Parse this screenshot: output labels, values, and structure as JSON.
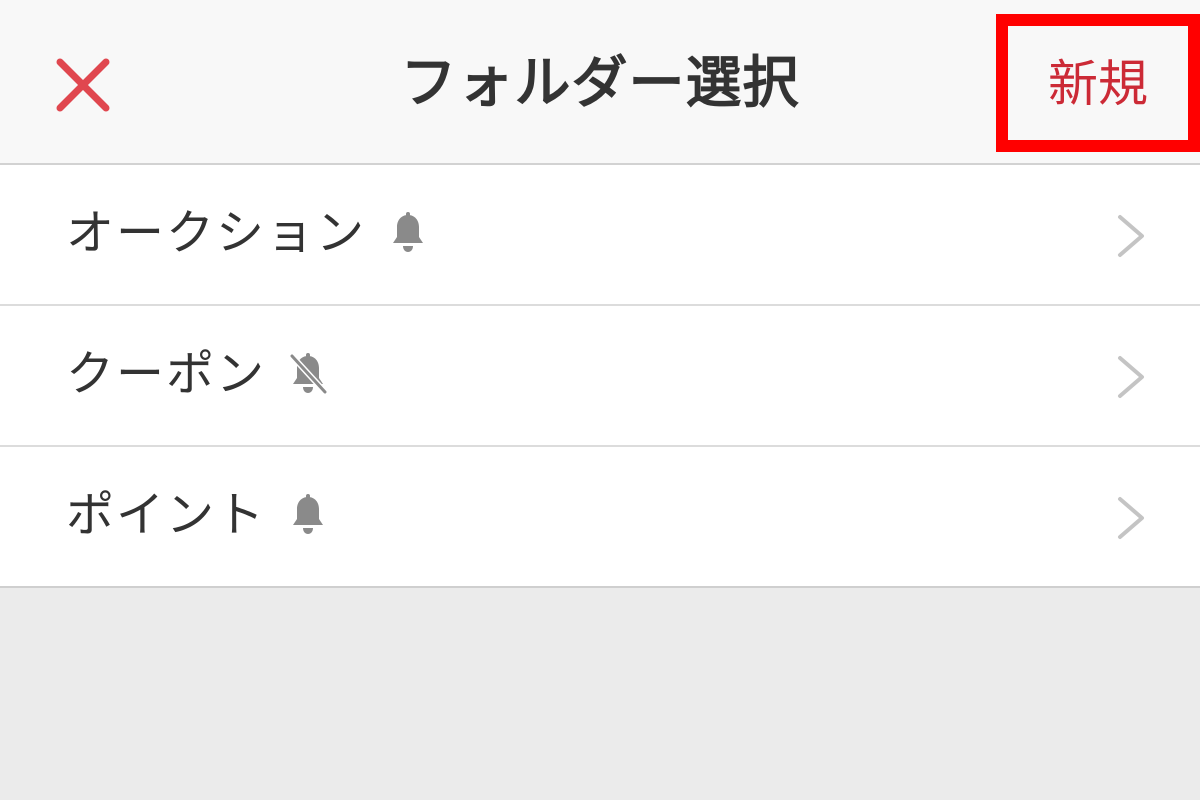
{
  "header": {
    "title": "フォルダー選択",
    "new_label": "新規",
    "close_icon": "close-icon",
    "close_color": "#e0474f"
  },
  "folders": [
    {
      "label": "オークション",
      "notification": "bell-icon"
    },
    {
      "label": "クーポン",
      "notification": "bell-off-icon"
    },
    {
      "label": "ポイント",
      "notification": "bell-icon"
    }
  ],
  "colors": {
    "accent": "#cc2a36",
    "highlight": "#ff0000",
    "icon_gray": "#8a8a8a",
    "chevron_gray": "#c4c4c4"
  }
}
